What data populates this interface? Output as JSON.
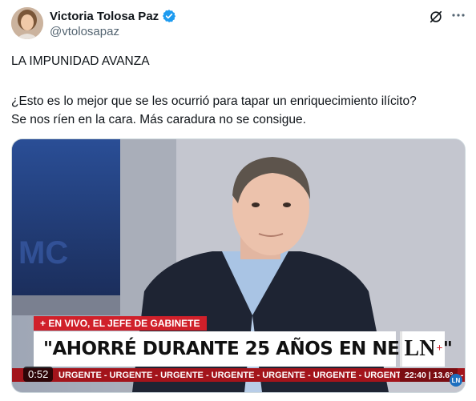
{
  "author": {
    "display_name": "Victoria Tolosa Paz",
    "handle": "@vtolosapaz",
    "avatar_icon": "profile-photo",
    "verified_icon": "verified-badge-icon"
  },
  "actions": {
    "grok_icon": "grok-icon",
    "more_icon": "more-options-icon"
  },
  "tweet": {
    "line1": "LA IMPUNIDAD AVANZA",
    "line2": "¿Esto es lo mejor que se les ocurrió para tapar un enriquecimiento ilícito?",
    "line3": "Se nos ríen en la cara. Más caradura no se consigue."
  },
  "video": {
    "live_label": "+ EN VIVO, EL JEFE DE GABINETE",
    "headline": "\"AHORRÉ DURANTE 25 AÑOS EN NEGRO\"",
    "channel_logo": "LN",
    "channel_logo_plus": "+",
    "ticker": "URGENTE - URGENTE - URGENTE - URGENTE - URGENTE - URGENTE - URGENTE - URGENTE - UR",
    "clock": "22:40 | 13.6°",
    "timestamp": "0:52",
    "corner_logo": "LN"
  },
  "colors": {
    "verified": "#1d9bf0",
    "handle": "#536471",
    "live_red": "#d0202a",
    "ticker_red": "#a3141b"
  }
}
